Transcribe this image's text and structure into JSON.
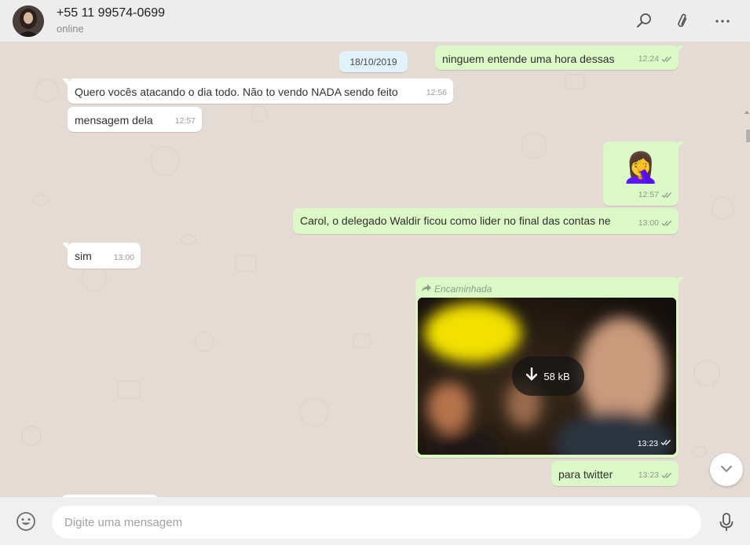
{
  "header": {
    "contact_name": "+55 11 99574-0699",
    "status": "online"
  },
  "chat": {
    "date_separator": "18/10/2019",
    "messages": [
      {
        "dir": "out",
        "text": "ninguem entende uma hora dessas",
        "time": "12:24",
        "ticks": "double"
      },
      {
        "dir": "in",
        "text": "Quero vocês atacando o dia todo. Não to vendo NADA sendo feito",
        "time": "12:56"
      },
      {
        "dir": "in",
        "text": "mensagem dela",
        "time": "12:57"
      },
      {
        "dir": "out",
        "emoji": "🤦‍♀️",
        "time": "12:57",
        "ticks": "double"
      },
      {
        "dir": "out",
        "text": "Carol, o delegado Waldir ficou como lider no final das contas ne",
        "time": "13:00",
        "ticks": "double"
      },
      {
        "dir": "in",
        "text": "sim",
        "time": "13:00"
      },
      {
        "dir": "out",
        "forwarded_label": "Encaminhada",
        "media_size": "58 kB",
        "time": "13:23",
        "ticks": "double"
      },
      {
        "dir": "out",
        "text": "para twitter",
        "time": "13:23",
        "ticks": "double"
      }
    ]
  },
  "footer": {
    "input_placeholder": "Digite uma mensagem"
  },
  "colors": {
    "outgoing_bubble": "#dcf8c6",
    "incoming_bubble": "#ffffff",
    "chat_background": "#e4dcd4",
    "header_background": "#ededed",
    "tick_color": "#8e9a8b"
  },
  "icons": [
    "search-icon",
    "attach-icon",
    "menu-icon",
    "forward-icon",
    "download-icon",
    "chevron-down-icon",
    "emoji-icon",
    "mic-icon"
  ]
}
